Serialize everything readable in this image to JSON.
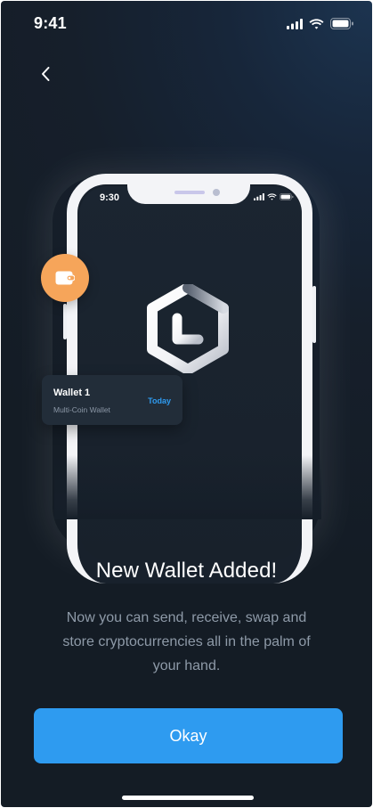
{
  "status_bar": {
    "time": "9:41",
    "icons": [
      "cellular-signal-icon",
      "wifi-icon",
      "battery-icon"
    ]
  },
  "navigation": {
    "back_icon": "chevron-left-icon"
  },
  "illustration": {
    "phone_time": "9:30",
    "phone_status_icons": [
      "cellular-signal-icon",
      "wifi-icon",
      "battery-icon"
    ],
    "logo_icon": "app-logo-icon",
    "wallet_badge_icon": "wallet-icon",
    "wallet_card": {
      "name": "Wallet 1",
      "type": "Multi-Coin Wallet",
      "date": "Today"
    }
  },
  "content": {
    "title": "New Wallet Added!",
    "description": "Now you can send, receive, swap and store cryptocurrencies all in the palm of your hand."
  },
  "actions": {
    "okay_label": "Okay"
  },
  "colors": {
    "background": "#161f2b",
    "accent": "#2e9bf0",
    "wallet_badge": "#f6a55a",
    "card": "#222d39",
    "muted_text": "#8e9aa8"
  }
}
